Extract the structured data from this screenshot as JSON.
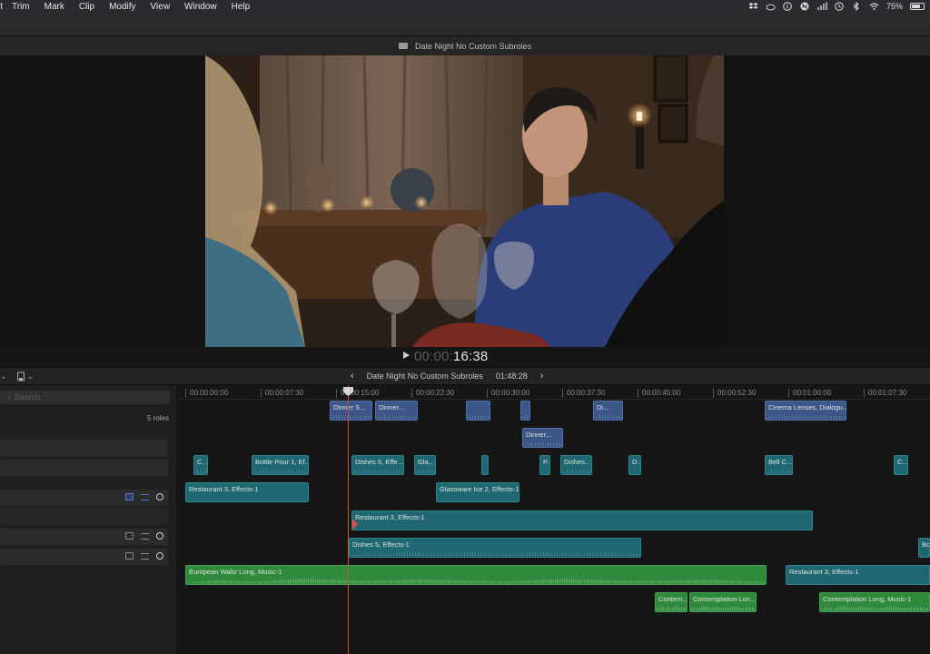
{
  "menubar": {
    "items": [
      "it",
      "Trim",
      "Mark",
      "Clip",
      "Modify",
      "View",
      "Window",
      "Help"
    ],
    "status": {
      "battery_text": "75%",
      "battery_fill": 0.75,
      "icons": [
        "dropbox-icon",
        "cloud-icon",
        "info-icon",
        "n-badge-icon",
        "network-icon",
        "time-machine-icon",
        "bluetooth-icon",
        "wifi-icon"
      ]
    }
  },
  "viewer": {
    "title": "Date Night No Custom Subroles",
    "timecode_dim": "00:00:",
    "timecode_bright": "16:38"
  },
  "timeline_header": {
    "project": "Date Night No Custom Subroles",
    "duration": "01:48:28"
  },
  "index": {
    "search_placeholder": "Search",
    "roles_count": "5 roles"
  },
  "ruler": [
    "00:00:00:00",
    "00:00:07:30",
    "00:00:15:00",
    "00:00:22:30",
    "00:00:30:00",
    "00:00:37:30",
    "00:00:45:00",
    "00:00:52:30",
    "00:01:00:00",
    "00:01:07:30"
  ],
  "clips": {
    "c1": "Dinner S...",
    "c2": "Dinner...",
    "c3": "Di...",
    "c4": "Cinema Lenses, Dialogu...",
    "c5": "Dinner...",
    "c6": "C...",
    "c7": "Bottle Pour 1, Ef...",
    "c8": "Dishes 6, Effe...",
    "c9": "Gla...",
    "c10": "P...",
    "c11": "Dishes...",
    "c12": "D...",
    "c13": "Bell C...",
    "c14": "C...",
    "c15": "Restaurant 3, Effects-1",
    "c16": "Glassware Ice 2, Effects-1",
    "c17": "Restaurant 3, Effects-1",
    "c18": "Dishes 5, Effects-1",
    "c19": "Bot",
    "c20": "European Waltz Long, Music-1",
    "c21": "Restaurant 3, Effects-1",
    "c22": "Contem...",
    "c23": "Contemplation Lon...",
    "c24": "Contemplation Long, Music-1"
  }
}
